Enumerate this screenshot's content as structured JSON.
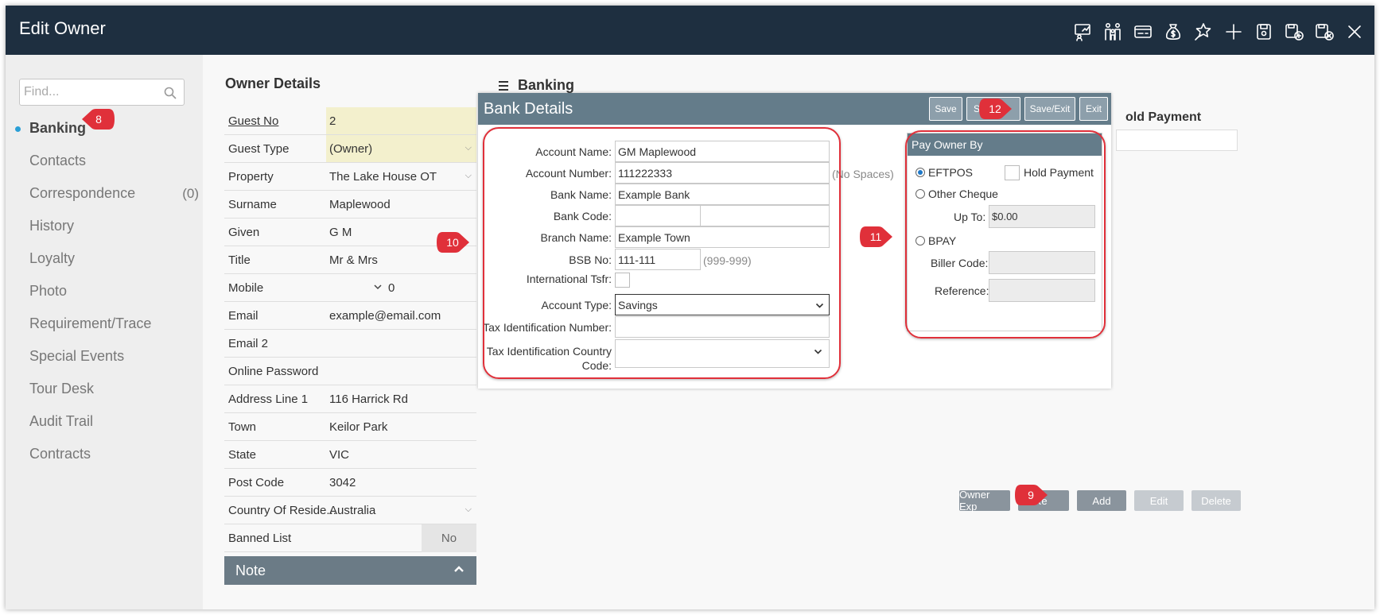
{
  "window": {
    "title": "Edit Owner"
  },
  "toolbar_icons": [
    "presentation-chart-icon",
    "family-icon",
    "id-card-icon",
    "money-bag-icon",
    "magic-wand-icon",
    "plus-icon",
    "save-icon",
    "save-new-icon",
    "save-close-icon",
    "close-icon"
  ],
  "sidebar": {
    "find_placeholder": "Find...",
    "items": [
      {
        "label": "Banking",
        "active": true
      },
      {
        "label": "Contacts"
      },
      {
        "label": "Correspondence",
        "count": "(0)"
      },
      {
        "label": "History"
      },
      {
        "label": "Loyalty"
      },
      {
        "label": "Photo"
      },
      {
        "label": "Requirement/Trace"
      },
      {
        "label": "Special Events"
      },
      {
        "label": "Tour Desk"
      },
      {
        "label": "Audit Trail"
      },
      {
        "label": "Contracts"
      }
    ]
  },
  "owner_details": {
    "heading": "Owner Details",
    "rows": [
      {
        "label": "Guest No",
        "value": "2"
      },
      {
        "label": "Guest Type",
        "value": "(Owner)"
      },
      {
        "label": "Property",
        "value": "The Lake House OT"
      },
      {
        "label": "Surname",
        "value": "Maplewood"
      },
      {
        "label": "Given",
        "value": "G M"
      },
      {
        "label": "Title",
        "value": "Mr & Mrs"
      },
      {
        "label": "Mobile",
        "value": "0"
      },
      {
        "label": "Email",
        "value": "example@email.com"
      },
      {
        "label": "Email 2",
        "value": ""
      },
      {
        "label": "Online Password",
        "value": ""
      },
      {
        "label": "Address Line 1",
        "value": "116 Harrick Rd"
      },
      {
        "label": "Town",
        "value": "Keilor Park"
      },
      {
        "label": "State",
        "value": "VIC"
      },
      {
        "label": "Post Code",
        "value": "3042"
      },
      {
        "label": "Country Of Reside...",
        "value": "Australia"
      },
      {
        "label": "Banned List",
        "value": "No"
      }
    ],
    "note_label": "Note"
  },
  "banking": {
    "heading": "Banking",
    "background_column": "old Payment",
    "bottom_buttons": [
      "Owner Exp",
      "Re",
      "Add",
      "Edit",
      "Delete"
    ]
  },
  "dialog": {
    "title": "Bank Details",
    "buttons": [
      "Save",
      "Sa",
      "Save/Exit",
      "Exit"
    ],
    "fields": {
      "account_name": {
        "label": "Account Name:",
        "value": "GM Maplewood"
      },
      "account_number": {
        "label": "Account Number:",
        "value": "111222333",
        "hint": "(No Spaces)"
      },
      "bank_name": {
        "label": "Bank Name:",
        "value": "Example Bank"
      },
      "bank_code": {
        "label": "Bank Code:",
        "value": ""
      },
      "branch_name": {
        "label": "Branch Name:",
        "value": "Example Town"
      },
      "bsb_no": {
        "label": "BSB No:",
        "value": "111-111",
        "hint": "(999-999)"
      },
      "international": {
        "label": "International Tsfr:"
      },
      "account_type": {
        "label": "Account Type:",
        "value": "Savings"
      },
      "tax_id": {
        "label": "Tax Identification Number:",
        "value": ""
      },
      "tax_country": {
        "label_line1": "Tax Identification Country",
        "label_line2": "Code:",
        "value": ""
      }
    },
    "pay_owner": {
      "heading": "Pay Owner By",
      "eftpos": "EFTPOS",
      "hold_payment": "Hold Payment",
      "other_cheque": "Other Cheque",
      "up_to_label": "Up To:",
      "up_to_value": "$0.00",
      "bpay": "BPAY",
      "biller_code_label": "Biller Code:",
      "reference_label": "Reference:"
    }
  },
  "callouts": [
    "8",
    "9",
    "10",
    "11",
    "12"
  ],
  "colors": {
    "header": "#1e2f40",
    "dialog_header": "#647c8a",
    "highlight": "#e0303a",
    "active_dot": "#2a9fd6"
  }
}
